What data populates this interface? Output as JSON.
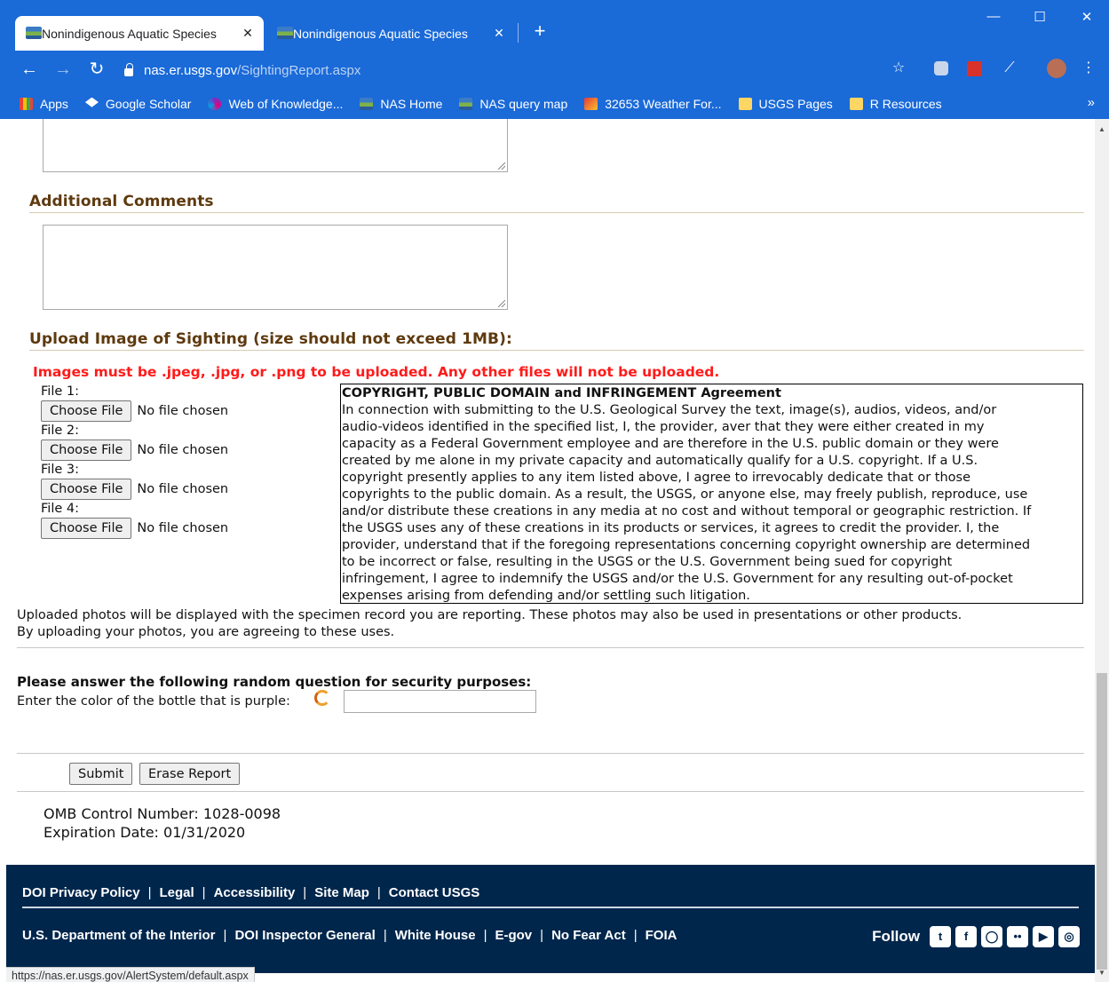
{
  "browser": {
    "tabs": [
      {
        "title": "Nonindigenous Aquatic Species",
        "active": true
      },
      {
        "title": "Nonindigenous Aquatic Species",
        "active": false
      }
    ],
    "new_tab": "+",
    "url_host": "nas.er.usgs.gov",
    "url_path": "/SightingReport.aspx",
    "bookmarks": [
      {
        "label": "Apps",
        "icon": "apps-grid-icon"
      },
      {
        "label": "Google Scholar",
        "icon": "scholar-icon"
      },
      {
        "label": "Web of Knowledge...",
        "icon": "wok-icon"
      },
      {
        "label": "NAS Home",
        "icon": "nas-icon"
      },
      {
        "label": "NAS query map",
        "icon": "nas-icon"
      },
      {
        "label": "32653 Weather For...",
        "icon": "weather-icon"
      },
      {
        "label": "USGS Pages",
        "icon": "folder-icon"
      },
      {
        "label": "R Resources",
        "icon": "folder-icon"
      }
    ],
    "bookmarks_more": "»",
    "status_url": "https://nas.er.usgs.gov/AlertSystem/default.aspx"
  },
  "form": {
    "additional_comments_heading": "Additional Comments",
    "upload_heading": "Upload Image of Sighting (size should not exceed 1MB):",
    "upload_warning": "Images must be .jpeg, .jpg, or .png to be uploaded. Any other files will not be uploaded.",
    "files": [
      {
        "label": "File 1:",
        "button": "Choose File",
        "status": "No file chosen"
      },
      {
        "label": "File 2:",
        "button": "Choose File",
        "status": "No file chosen"
      },
      {
        "label": "File 3:",
        "button": "Choose File",
        "status": "No file chosen"
      },
      {
        "label": "File 4:",
        "button": "Choose File",
        "status": "No file chosen"
      }
    ],
    "copyright_title": "COPYRIGHT, PUBLIC DOMAIN and INFRINGEMENT Agreement",
    "copyright_lines": [
      "In connection with submitting to the U.S. Geological Survey the text, image(s), audios, videos, and/or",
      "audio-videos identified in the specified list, I, the provider, aver that they were either created in my",
      "capacity as a Federal Government employee and are therefore in the U.S. public domain or they were",
      "created by me alone in my private capacity and automatically qualify for a U.S. copyright. If a U.S.",
      "copyright presently applies to any item listed above, I agree to irrevocably dedicate that or those",
      "copyrights to the public domain. As a result, the USGS, or anyone else, may freely publish, reproduce, use",
      "and/or distribute these creations in any media at no cost and without temporal or geographic restriction. If",
      "the USGS uses any of these creations in its products or services, it agrees to credit the provider. I, the",
      "provider, understand that if the foregoing representations concerning copyright ownership are determined",
      "to be incorrect or false, resulting in the USGS or the U.S. Government being sued for copyright",
      "infringement, I agree to indemnify the USGS and/or the U.S. Government for any resulting out-of-pocket",
      "expenses arising from defending and/or settling such litigation."
    ],
    "upload_note_1": "Uploaded photos will be displayed with the specimen record you are reporting. These photos may also be used in presentations or other products.",
    "upload_note_2": "By uploading your photos, you are agreeing to these uses.",
    "security_heading": "Please answer the following random question for security purposes:",
    "security_question": "Enter the color of the bottle that is purple:",
    "security_answer": "",
    "submit_label": "Submit",
    "erase_label": "Erase Report",
    "omb_number": "OMB Control Number: 1028-0098",
    "expiration": "Expiration Date: 01/31/2020"
  },
  "footer": {
    "row1": [
      "DOI Privacy Policy",
      "Legal",
      "Accessibility",
      "Site Map",
      "Contact USGS"
    ],
    "row2": [
      "U.S. Department of the Interior",
      "DOI Inspector General",
      "White House",
      "E-gov",
      "No Fear Act",
      "FOIA"
    ],
    "follow_label": "Follow",
    "social": [
      {
        "icon": "twitter-icon",
        "glyph": "t"
      },
      {
        "icon": "facebook-icon",
        "glyph": "f"
      },
      {
        "icon": "github-icon",
        "glyph": "◯"
      },
      {
        "icon": "flickr-icon",
        "glyph": "••"
      },
      {
        "icon": "youtube-icon",
        "glyph": "▶"
      },
      {
        "icon": "instagram-icon",
        "glyph": "◎"
      }
    ]
  },
  "colors": {
    "chrome_blue": "#1a6ad8",
    "heading_brown": "#5e3a0f",
    "warning_red": "#ff1a1a",
    "footer_navy": "#00264c"
  }
}
